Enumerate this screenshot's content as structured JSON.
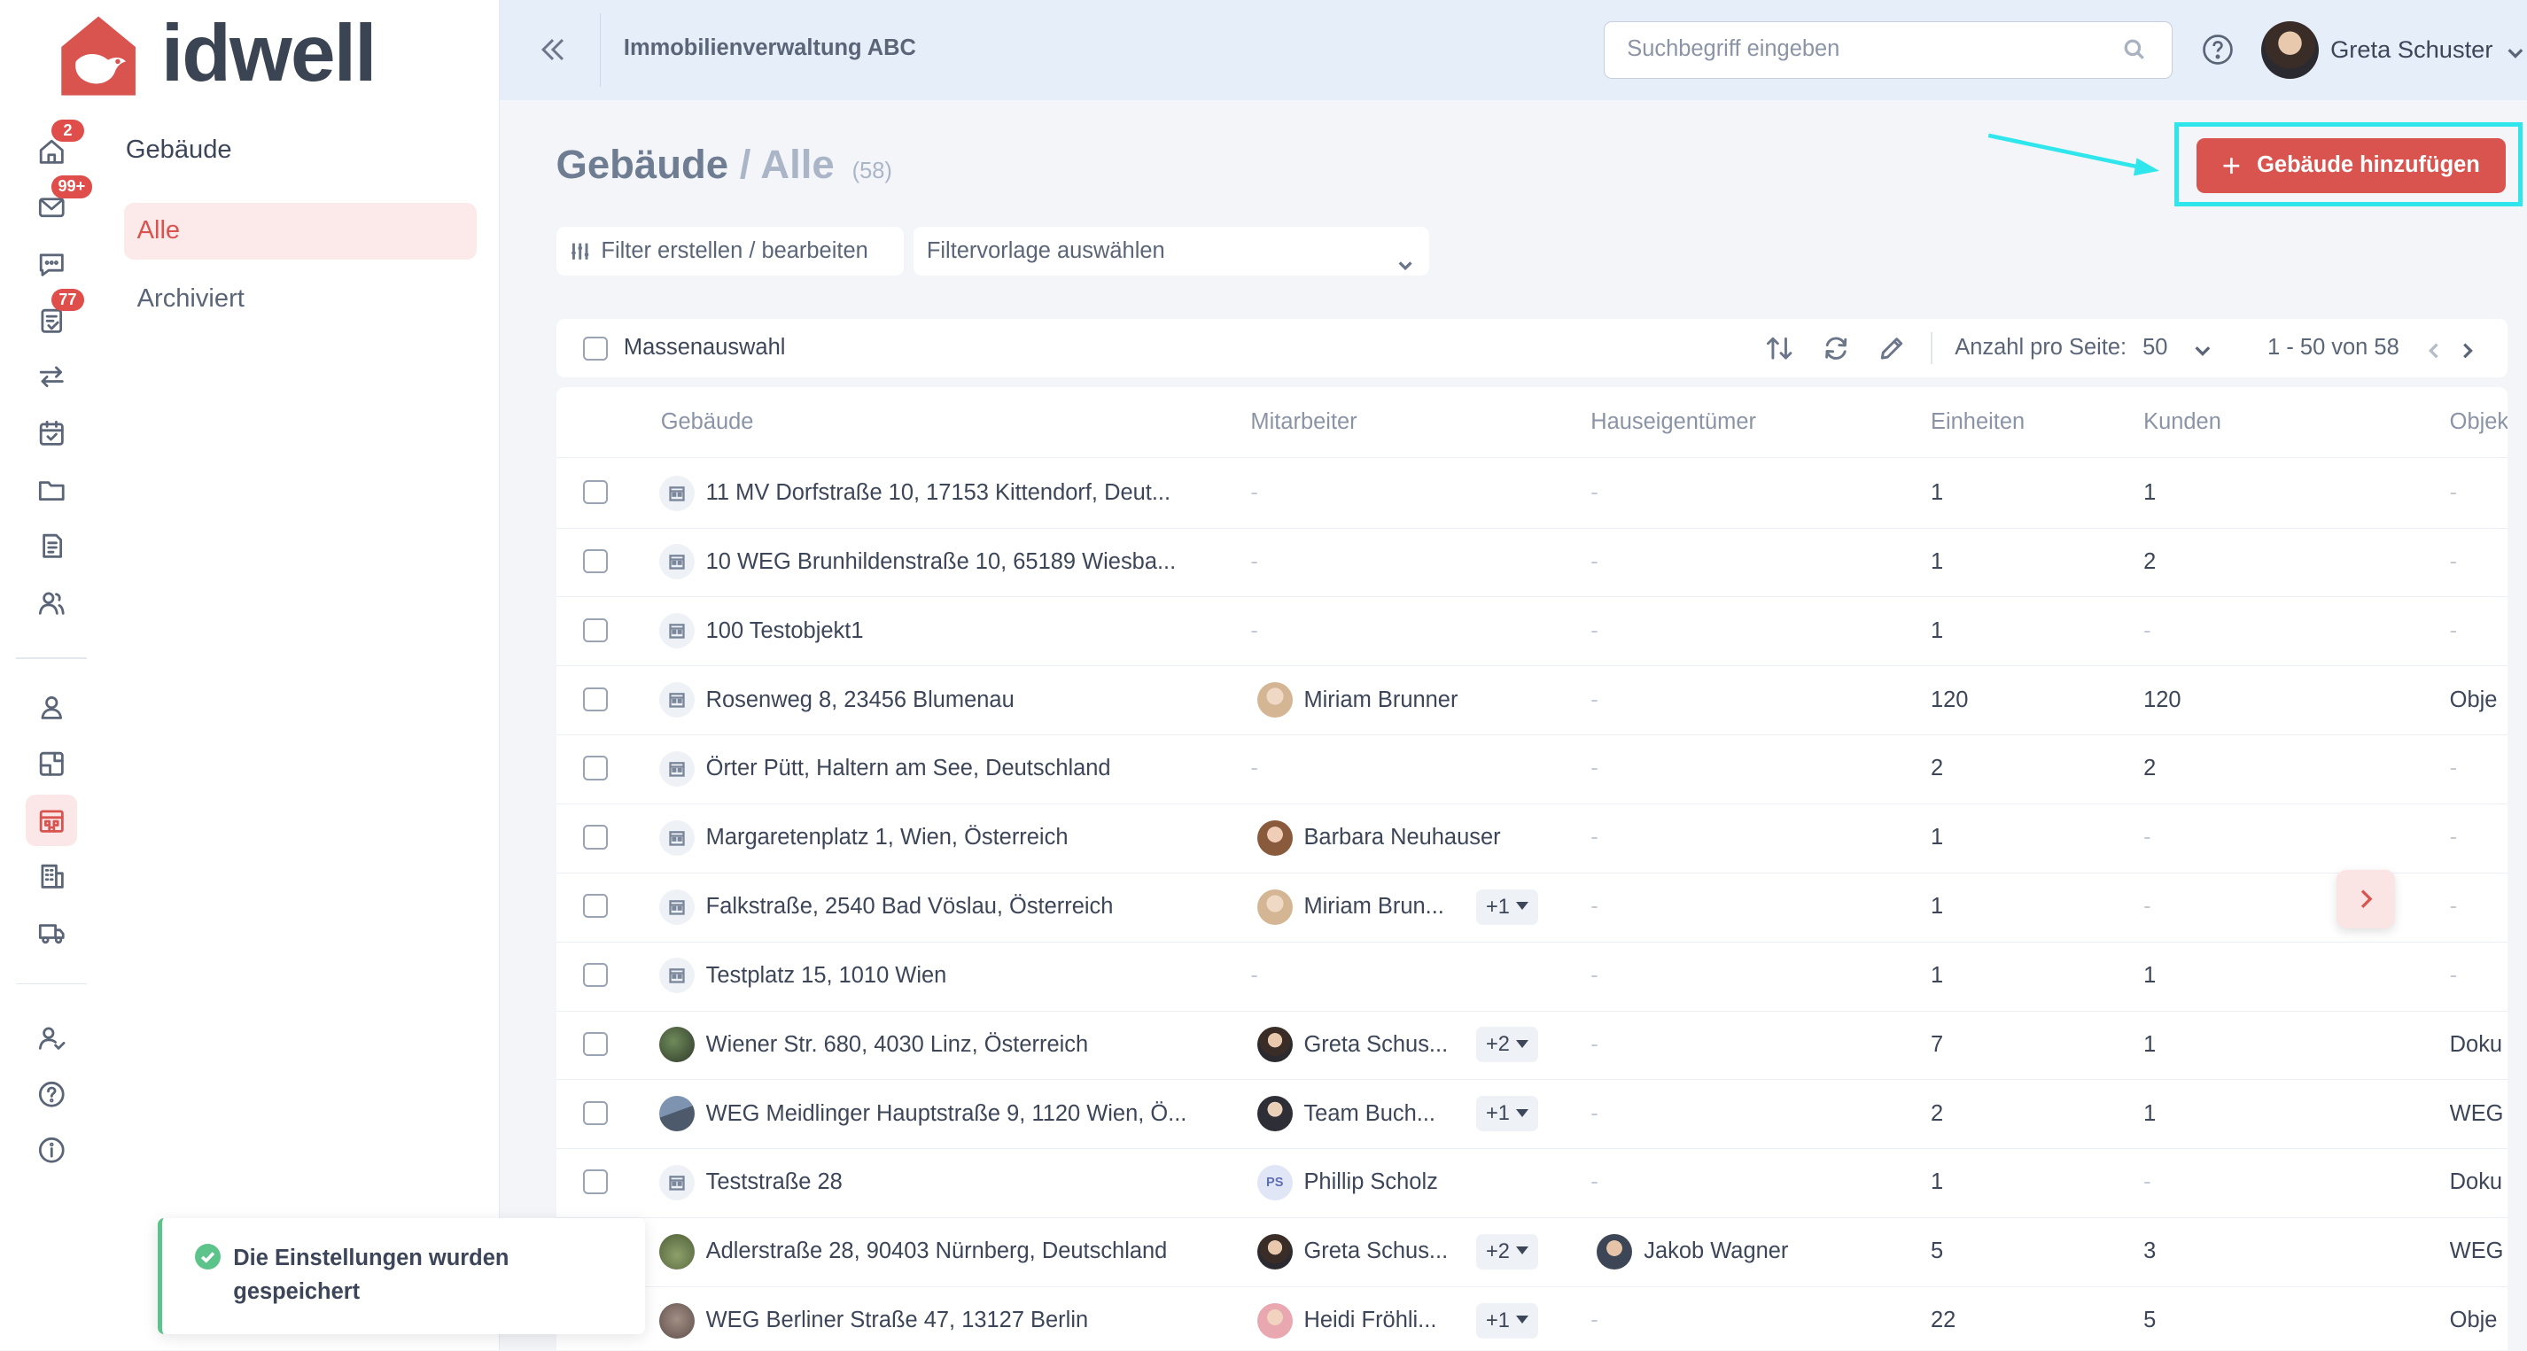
{
  "brand": {
    "name": "idwell",
    "color": "#d9534f"
  },
  "rail": {
    "badges": {
      "home": "2",
      "mail": "99+",
      "docs": "77"
    }
  },
  "subnav": {
    "title": "Gebäude",
    "items": [
      {
        "label": "Alle",
        "active": true
      },
      {
        "label": "Archiviert",
        "active": false
      }
    ]
  },
  "topbar": {
    "org": "Immobilienverwaltung ABC",
    "search_placeholder": "Suchbegriff eingeben",
    "user_name": "Greta Schuster"
  },
  "page": {
    "title": "Gebäude",
    "separator": "/",
    "subtitle": "Alle",
    "count": "(58)",
    "add_button": "Gebäude hinzufügen"
  },
  "filters": {
    "create_label": "Filter erstellen / bearbeiten",
    "preset_placeholder": "Filtervorlage auswählen"
  },
  "toolbar": {
    "mass_select": "Massenauswahl",
    "per_page_label": "Anzahl pro Seite:",
    "per_page_value": "50",
    "range": "1 - 50 von 58"
  },
  "table": {
    "columns": [
      "Gebäude",
      "Mitarbeiter",
      "Hauseigentümer",
      "Einheiten",
      "Kunden",
      "Objek"
    ],
    "rows": [
      {
        "building": "11 MV Dorfstraße 10, 17153 Kittendorf, Deut...",
        "employee": "-",
        "plus": "",
        "owner": "-",
        "units": "1",
        "customers": "1",
        "obj": "-"
      },
      {
        "building": "10 WEG Brunhildenstraße 10, 65189 Wiesba...",
        "employee": "-",
        "plus": "",
        "owner": "-",
        "units": "1",
        "customers": "2",
        "obj": "-"
      },
      {
        "building": "100 Testobjekt1",
        "employee": "-",
        "plus": "",
        "owner": "-",
        "units": "1",
        "customers": "-",
        "obj": "-"
      },
      {
        "building": "Rosenweg 8, 23456 Blumenau",
        "employee": "Miriam Brunner",
        "plus": "",
        "owner": "-",
        "units": "120",
        "customers": "120",
        "obj": "Obje"
      },
      {
        "building": "Örter Pütt, Haltern am See, Deutschland",
        "employee": "-",
        "plus": "",
        "owner": "-",
        "units": "2",
        "customers": "2",
        "obj": "-"
      },
      {
        "building": "Margaretenplatz 1, Wien, Österreich",
        "employee": "Barbara Neuhauser",
        "plus": "",
        "owner": "-",
        "units": "1",
        "customers": "-",
        "obj": "-"
      },
      {
        "building": "Falkstraße, 2540 Bad Vöslau, Österreich",
        "employee": "Miriam Brun...",
        "plus": "+1",
        "owner": "-",
        "units": "1",
        "customers": "-",
        "obj": "-"
      },
      {
        "building": "Testplatz 15, 1010 Wien",
        "employee": "-",
        "plus": "",
        "owner": "-",
        "units": "1",
        "customers": "1",
        "obj": "-"
      },
      {
        "building": "Wiener Str. 680, 4030 Linz, Österreich",
        "employee": "Greta Schus...",
        "plus": "+2",
        "owner": "-",
        "units": "7",
        "customers": "1",
        "obj": "Doku"
      },
      {
        "building": "WEG Meidlinger Hauptstraße 9, 1120 Wien, Ö...",
        "employee": "Team Buch...",
        "plus": "+1",
        "owner": "-",
        "units": "2",
        "customers": "1",
        "obj": "WEG"
      },
      {
        "building": "Teststraße 28",
        "employee": "Phillip Scholz",
        "plus": "",
        "owner": "-",
        "units": "1",
        "customers": "-",
        "obj": "Doku"
      },
      {
        "building": "Adlerstraße 28, 90403 Nürnberg, Deutschland",
        "employee": "Greta Schus...",
        "plus": "+2",
        "owner": "Jakob Wagner",
        "units": "5",
        "customers": "3",
        "obj": "WEG"
      },
      {
        "building": "WEG Berliner Straße 47, 13127 Berlin",
        "employee": "Heidi Fröhli...",
        "plus": "+1",
        "owner": "-",
        "units": "22",
        "customers": "5",
        "obj": "Obje"
      }
    ]
  },
  "avatars": {
    "ps_initials": "PS"
  },
  "toast": {
    "message": "Die Einstellungen wurden gespeichert"
  }
}
